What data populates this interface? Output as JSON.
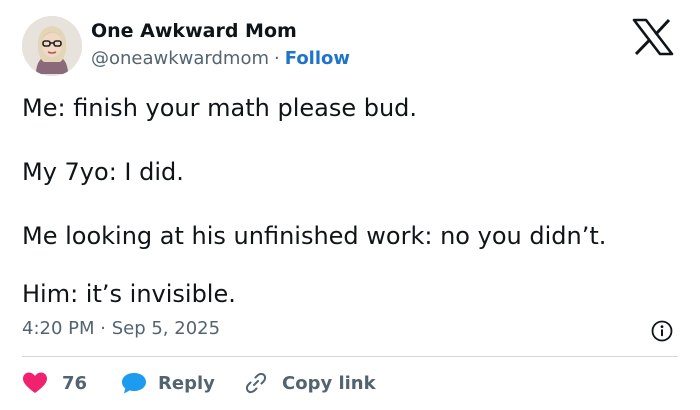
{
  "author": {
    "name": "One Awkward Mom",
    "handle": "@oneawkwardmom",
    "separator": "·",
    "follow_label": "Follow"
  },
  "platform_icon": "x-logo-icon",
  "tweet": {
    "lines": [
      "Me: finish your math please bud.",
      "My 7yo: I did.",
      "Me looking at his unfinished work: no you didn’t.",
      "Him: it’s invisible."
    ],
    "timestamp": "4:20 PM · Sep 5, 2025"
  },
  "actions": {
    "like_count": "76",
    "reply_label": "Reply",
    "copy_link_label": "Copy link"
  },
  "colors": {
    "link_blue": "#1d74c9",
    "like_pink": "#f0226f",
    "reply_blue": "#1d9bf0",
    "muted_gray": "#536471"
  }
}
